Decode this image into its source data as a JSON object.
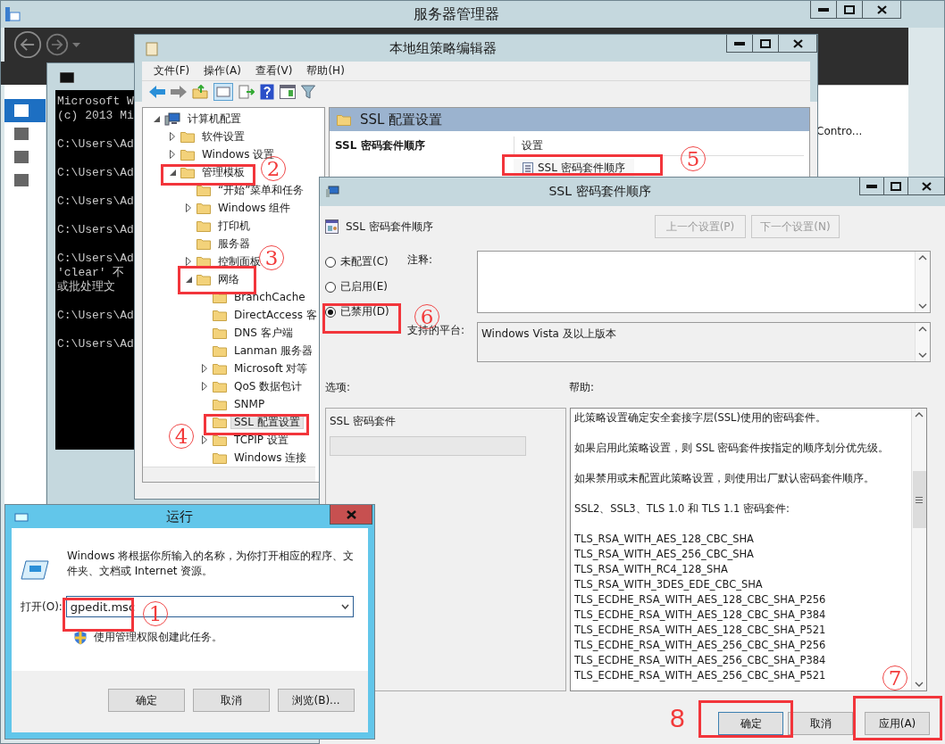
{
  "server_manager": {
    "title": "服务器管理器",
    "nav_items": [
      {
        "selected": true
      },
      {
        "selected": false
      },
      {
        "selected": false
      },
      {
        "selected": false
      }
    ],
    "side_text": "Contro..."
  },
  "console": {
    "line_groups": [
      [
        "Microsoft W",
        "(c) 2013 Mi"
      ],
      [
        "C:\\Users\\Ad"
      ],
      [
        "C:\\Users\\Ad"
      ],
      [
        "C:\\Users\\Ad"
      ],
      [
        "C:\\Users\\Ad"
      ],
      [
        "C:\\Users\\Ad",
        "'clear' 不",
        "或批处理文"
      ],
      [
        "C:\\Users\\Ad"
      ],
      [
        "C:\\Users\\Ad"
      ]
    ]
  },
  "gpe": {
    "title": "本地组策略编辑器",
    "menu": [
      "文件(F)",
      "操作(A)",
      "查看(V)",
      "帮助(H)"
    ],
    "tree": [
      {
        "label": "计算机配置",
        "kind": "computer",
        "expanded": true,
        "selected": false,
        "children": [
          {
            "label": "软件设置",
            "kind": "folder",
            "expanded": false,
            "selected": false
          },
          {
            "label": "Windows 设置",
            "kind": "folder",
            "expanded": false,
            "selected": false
          },
          {
            "label": "管理模板",
            "kind": "folder",
            "expanded": true,
            "selected": false,
            "children": [
              {
                "label": "“开始”菜单和任务",
                "kind": "folder",
                "selected": false
              },
              {
                "label": "Windows 组件",
                "kind": "folder",
                "expanded": false,
                "selected": false
              },
              {
                "label": "打印机",
                "kind": "folder",
                "selected": false
              },
              {
                "label": "服务器",
                "kind": "folder",
                "selected": false
              },
              {
                "label": "控制面板",
                "kind": "folder",
                "expanded": false,
                "selected": false
              },
              {
                "label": "网络",
                "kind": "folder",
                "expanded": true,
                "selected": false,
                "children": [
                  {
                    "label": "BranchCache",
                    "kind": "folder",
                    "selected": false
                  },
                  {
                    "label": "DirectAccess 客",
                    "kind": "folder",
                    "selected": false
                  },
                  {
                    "label": "DNS 客户端",
                    "kind": "folder",
                    "selected": false
                  },
                  {
                    "label": "Lanman 服务器",
                    "kind": "folder",
                    "selected": false
                  },
                  {
                    "label": "Microsoft 对等",
                    "kind": "folder",
                    "expanded": false,
                    "selected": false
                  },
                  {
                    "label": "QoS 数据包计",
                    "kind": "folder",
                    "expanded": false,
                    "selected": false
                  },
                  {
                    "label": "SNMP",
                    "kind": "folder",
                    "selected": false
                  },
                  {
                    "label": "SSL 配置设置",
                    "kind": "folder",
                    "selected": true
                  },
                  {
                    "label": "TCPIP 设置",
                    "kind": "folder",
                    "expanded": false,
                    "selected": false
                  },
                  {
                    "label": "Windows 连接",
                    "kind": "folder",
                    "selected": false
                  }
                ]
              }
            ]
          }
        ]
      }
    ],
    "pane_title": "SSL 配置设置",
    "policy_name": "SSL 密码套件顺序",
    "list_column": "设置",
    "list_items": [
      {
        "label": "SSL 密码套件顺序",
        "selected": false
      }
    ]
  },
  "policy_dialog": {
    "title": "SSL 密码套件顺序",
    "policy_name": "SSL 密码套件顺序",
    "nav_buttons": [
      {
        "label": "上一个设置(P)",
        "disabled": true
      },
      {
        "label": "下一个设置(N)",
        "disabled": true
      }
    ],
    "options": [
      {
        "label": "未配置(C)",
        "selected": false
      },
      {
        "label": "已启用(E)",
        "selected": false
      },
      {
        "label": "已禁用(D)",
        "selected": true
      }
    ],
    "comment_label": "注释:",
    "platform_label": "支持的平台:",
    "platform_value": "Windows Vista 及以上版本",
    "options_label": "选项:",
    "help_label": "帮助:",
    "option_field_label": "SSL 密码套件",
    "help_paragraphs": [
      "此策略设置确定安全套接字层(SSL)使用的密码套件。",
      "如果启用此策略设置，则 SSL 密码套件按指定的顺序划分优先级。",
      "如果禁用或未配置此策略设置，则使用出厂默认密码套件顺序。",
      "SSL2、SSL3、TLS 1.0 和 TLS 1.1 密码套件:"
    ],
    "help_suites": [
      "TLS_RSA_WITH_AES_128_CBC_SHA",
      "TLS_RSA_WITH_AES_256_CBC_SHA",
      "TLS_RSA_WITH_RC4_128_SHA",
      "TLS_RSA_WITH_3DES_EDE_CBC_SHA",
      "TLS_ECDHE_RSA_WITH_AES_128_CBC_SHA_P256",
      "TLS_ECDHE_RSA_WITH_AES_128_CBC_SHA_P384",
      "TLS_ECDHE_RSA_WITH_AES_128_CBC_SHA_P521",
      "TLS_ECDHE_RSA_WITH_AES_256_CBC_SHA_P256",
      "TLS_ECDHE_RSA_WITH_AES_256_CBC_SHA_P384",
      "TLS_ECDHE_RSA_WITH_AES_256_CBC_SHA_P521"
    ],
    "buttons": [
      "确定",
      "取消",
      "应用(A)"
    ]
  },
  "run_dialog": {
    "title": "运行",
    "description": "Windows 将根据你所输入的名称，为你打开相应的程序、文件夹、文档或 Internet 资源。",
    "open_label": "打开(O):",
    "value": "gpedit.msc",
    "admin_note": "使用管理权限创建此任务。",
    "buttons": [
      "确定",
      "取消",
      "浏览(B)..."
    ]
  },
  "annotations": [
    {
      "text": "1",
      "kind": "circled"
    },
    {
      "text": "2",
      "kind": "circled"
    },
    {
      "text": "3",
      "kind": "circled"
    },
    {
      "text": "4",
      "kind": "circled"
    },
    {
      "text": "5",
      "kind": "circled"
    },
    {
      "text": "6",
      "kind": "circled"
    },
    {
      "text": "7",
      "kind": "circled"
    },
    {
      "text": "8",
      "kind": "plain"
    }
  ]
}
